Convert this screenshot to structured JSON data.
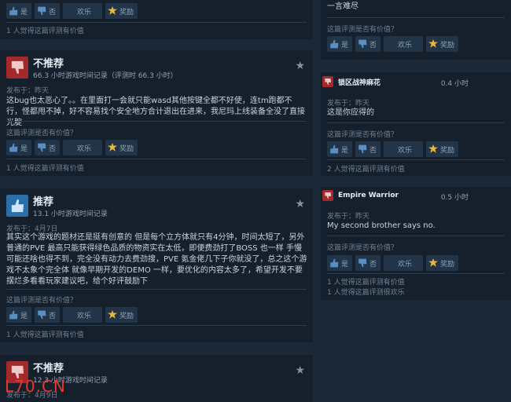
{
  "vote": {
    "yes": "是",
    "no": "否",
    "funny": "欢乐",
    "award": "奖励"
  },
  "question": "这篇评测是否有价值？",
  "left": {
    "top_helpful": "1 人觉得这篇评测有价值",
    "reviews": [
      {
        "verdict": "不推荐",
        "recommended": false,
        "hours": "66.3 小时游戏时间记录（评测时 66.3 小时）",
        "posted": "发布于：昨天",
        "body": "这bug也太恶心了。。在里面打一会就只能wasd其他按键全都不好使，连tm跑都不行，怪都甩不掉，好不容易找个安全地方合计退出在进来，我尼玛上线装备全没了直接光腚",
        "helpful": "1 人觉得这篇评测有价值"
      },
      {
        "verdict": "推荐",
        "recommended": true,
        "hours": "13.1 小时游戏时间记录",
        "posted": "发布于：4月7日",
        "body": "其实这个游戏的题材还是挺有创意的 但是每个立方体就只有4分钟，时间太短了，另外普通的PVE 最高只能获得绿色品质的物资实在太低，即便费劲打了BOSS 也一样 手慢可能还啥也得不到，完全没有动力去费劲搜，PVE 氪金佬几下子你就没了，总之这个游戏不太象个完全体 就像早期开发的DEMO 一样，要优化的内容太多了，希望开发不要摆烂多看看玩家建议吧，给个好评鼓励下",
        "helpful": "1 人觉得这篇评测有价值"
      },
      {
        "verdict": "不推荐",
        "recommended": false,
        "hours": "12.3 小时游戏时间记录",
        "posted": "发布于：4月9日"
      }
    ]
  },
  "right": {
    "top_text": "一言难尽",
    "reviews": [
      {
        "user": "锁区战神麻花",
        "hours": "0.4 小时",
        "posted": "发布于：昨天",
        "body": "这是你应得的",
        "helpful": [
          "2 人觉得这篇评测有价值"
        ]
      },
      {
        "user": "Empire Warrior",
        "hours": "0.5 小时",
        "posted": "发布于：昨天",
        "body": "My second brother says no.",
        "helpful": [
          "1 人觉得这篇评测有价值",
          "1 人觉得这篇评测很欢乐"
        ]
      }
    ]
  },
  "watermark": "L70.CN"
}
